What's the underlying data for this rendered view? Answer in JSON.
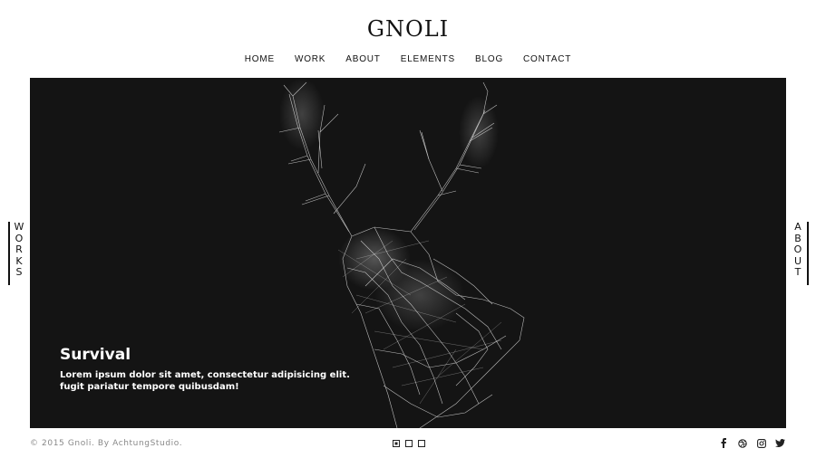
{
  "brand": {
    "name": "GNOLI"
  },
  "nav": {
    "items": [
      {
        "label": "HOME"
      },
      {
        "label": "WORK"
      },
      {
        "label": "ABOUT"
      },
      {
        "label": "ELEMENTS"
      },
      {
        "label": "BLOG"
      },
      {
        "label": "CONTACT"
      }
    ]
  },
  "side_left": {
    "letters": [
      "W",
      "O",
      "R",
      "K",
      "S"
    ]
  },
  "side_right": {
    "letters": [
      "A",
      "B",
      "O",
      "U",
      "T"
    ]
  },
  "hero": {
    "title": "Survival",
    "text_line1": "Lorem ipsum dolor sit amet, consectetur adipisicing elit.",
    "text_line2": "fugit pariatur tempore quibusdam!",
    "background": "#141414",
    "image": "deer-polygon-illustration"
  },
  "footer": {
    "copyright": "© 2015 Gnoli. By AchtungStudio.",
    "slider_dots": 3,
    "active_dot": 1,
    "social": [
      "facebook-icon",
      "dribbble-icon",
      "instagram-icon",
      "twitter-icon"
    ]
  }
}
